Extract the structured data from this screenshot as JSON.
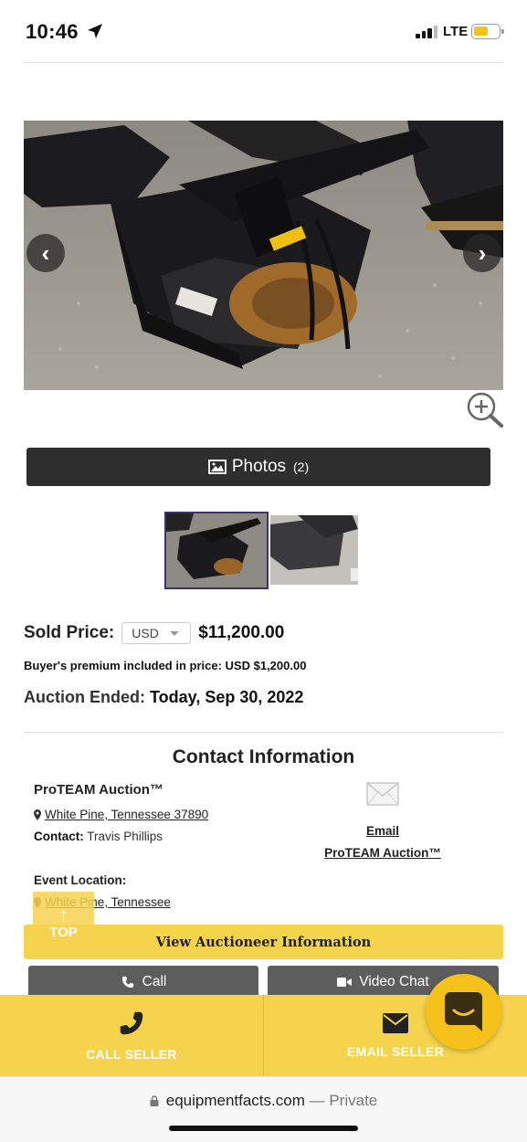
{
  "status_bar": {
    "time": "10:46",
    "network": "LTE"
  },
  "listing": {
    "photos_label": "Photos",
    "photos_count": "(2)",
    "sold_price_label": "Sold Price:",
    "currency": "USD",
    "sold_price": "$11,200.00",
    "premium_label": "Buyer's premium included in price:",
    "premium_value": "USD $1,200.00",
    "auction_ended_label": "Auction Ended:",
    "auction_ended_value": "Today, Sep 30, 2022"
  },
  "contact": {
    "heading": "Contact Information",
    "company": "ProTEAM Auction™",
    "location": "White Pine, Tennessee 37890",
    "contact_label": "Contact:",
    "contact_name": "Travis Phillips",
    "email_line1": "Email",
    "email_line2": "ProTEAM Auction™",
    "event_location_label": "Event Location:",
    "event_location": "White Pine, Tennessee"
  },
  "actions": {
    "top_label": "TOP",
    "view_auctioneer": "View Auctioneer Information",
    "call": "Call",
    "video_chat": "Video Chat",
    "call_seller": "CALL SELLER",
    "email_seller": "EMAIL SELLER"
  },
  "browser": {
    "domain": "equipmentfacts.com",
    "separator": "—",
    "mode": "Private"
  },
  "colors": {
    "accent_yellow": "#f6d34c",
    "fab_yellow": "#f4c21a",
    "dark_button": "#2e2e2e",
    "gray_button": "#5d5d5d"
  },
  "icons": [
    "location-arrow-icon",
    "signal-icon",
    "battery-icon",
    "chevron-left-icon",
    "chevron-right-icon",
    "zoom-in-icon",
    "image-icon",
    "pin-icon",
    "envelope-icon",
    "phone-icon",
    "video-icon",
    "chat-icon",
    "lock-icon",
    "arrow-up-icon"
  ]
}
